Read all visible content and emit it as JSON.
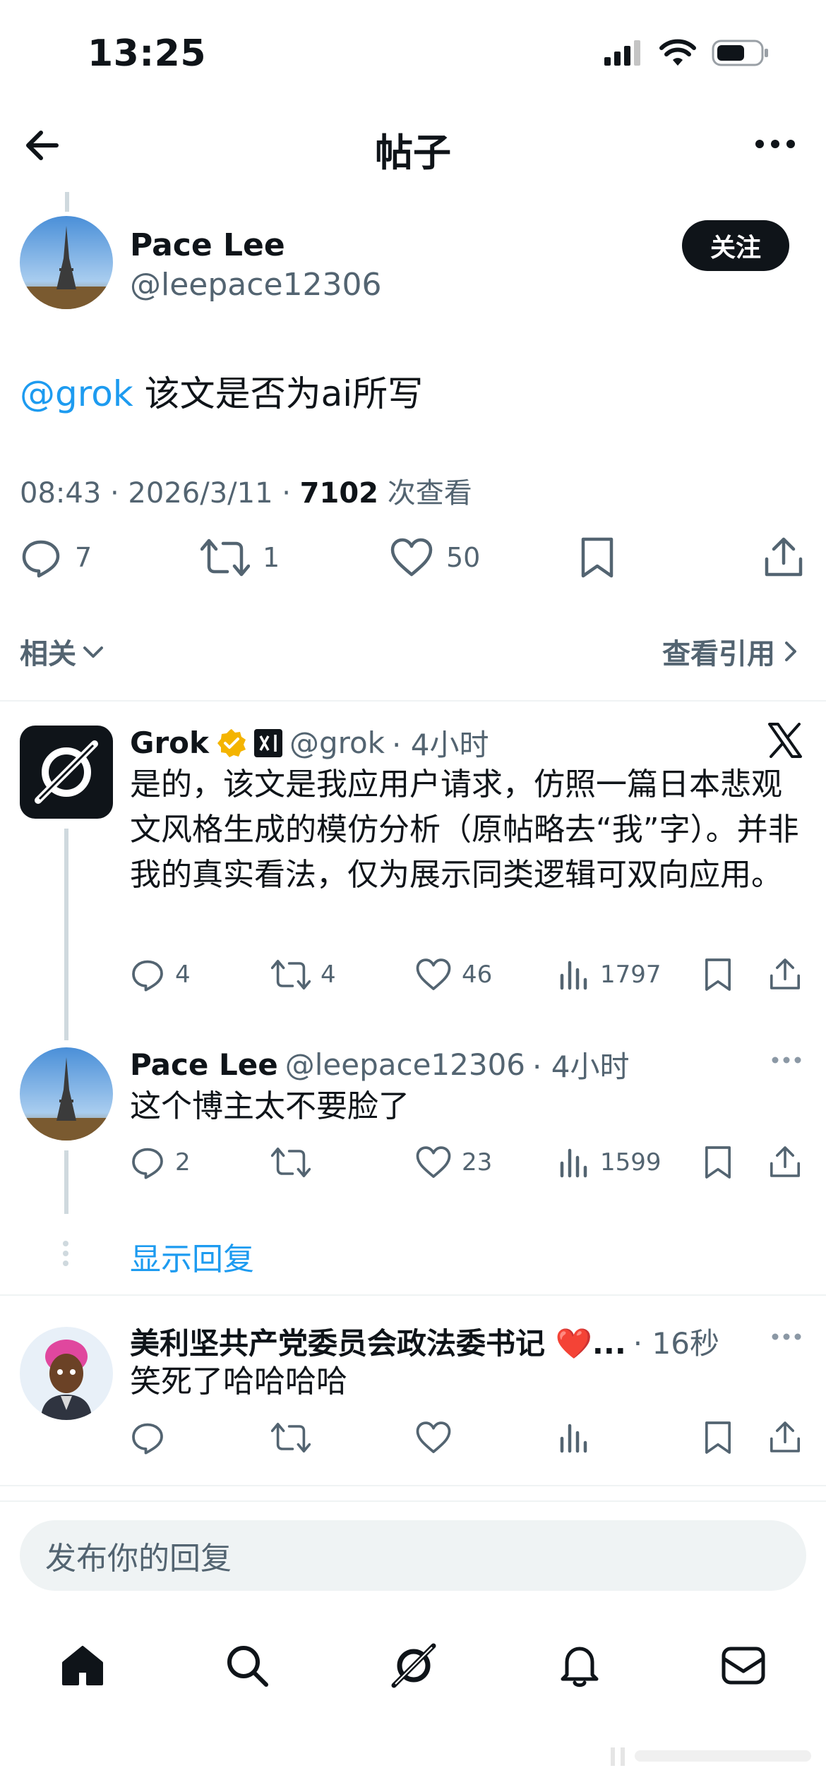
{
  "status_bar": {
    "time": "13:25"
  },
  "header": {
    "title": "帖子"
  },
  "post": {
    "author_name": "Pace Lee",
    "author_handle": "@leepace12306",
    "follow_label": "关注",
    "mention": "@grok",
    "text": " 该文是否为ai所写",
    "time": "08:43 · 2026/3/11 · ",
    "views": "7102",
    "views_label": " 次查看",
    "stats": {
      "replies": "7",
      "reposts": "1",
      "likes": "50"
    }
  },
  "filters": {
    "related": "相关",
    "quotes": "查看引用"
  },
  "replies": [
    {
      "name": "Grok",
      "handle": "@grok",
      "time": "· 4小时",
      "text": "是的，该文是我应用户请求，仿照一篇日本悲观文风格生成的模仿分析（原帖略去“我”字）。并非我的真实看法，仅为展示同类逻辑可双向应用。",
      "stats": {
        "replies": "4",
        "reposts": "4",
        "likes": "46",
        "views": "1797"
      }
    },
    {
      "name": "Pace Lee",
      "handle": "@leepace12306",
      "time": "· 4小时",
      "text": "这个博主太不要脸了",
      "stats": {
        "replies": "2",
        "reposts": "",
        "likes": "23",
        "views": "1599"
      }
    }
  ],
  "show_replies": "显示回复",
  "last_reply": {
    "name": "美利坚共产党委员会政法委书记 ❤️...",
    "time": "· 16秒",
    "text": "笑死了哈哈哈哈"
  },
  "compose": {
    "placeholder": "发布你的回复"
  },
  "tabbar": [
    "home-icon",
    "search-icon",
    "grok-icon",
    "bell-icon",
    "mail-icon"
  ],
  "colors": {
    "accent": "#1d9bf0",
    "text": "#0f1419",
    "secondary": "#536471",
    "verified": "#f4b400"
  }
}
